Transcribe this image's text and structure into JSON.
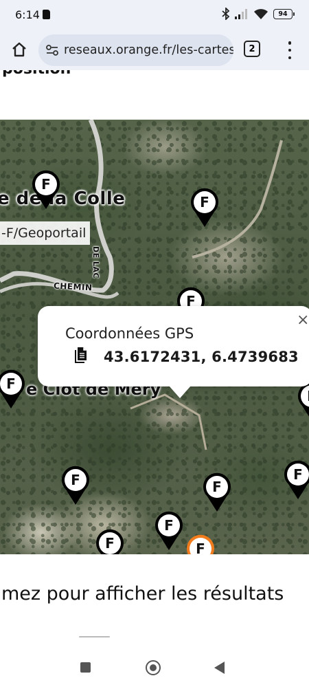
{
  "status_bar": {
    "time": "6:14",
    "battery": "94"
  },
  "toolbar": {
    "url": "reseaux.orange.fr/les-cartes",
    "tab_count": "2"
  },
  "page": {
    "heading": "position",
    "results_prompt": "mez pour afficher les résultats"
  },
  "map": {
    "labels": {
      "place_colle": "e de la Colle",
      "place_clot": "e Clot de Mery",
      "road_chemin": "CHEMIN",
      "road_lac": "DE LAC"
    },
    "attribution": "-F/Geoportail",
    "pin_letter": "F",
    "pins": [
      {
        "color": "#000000"
      },
      {
        "color": "#000000"
      },
      {
        "color": "#000000"
      },
      {
        "color": "#000000"
      },
      {
        "color": "#000000"
      },
      {
        "color": "#000000"
      },
      {
        "color": "#000000"
      },
      {
        "color": "#000000"
      },
      {
        "color": "#000000"
      },
      {
        "color": "#000000"
      },
      {
        "color": "#f07c1e"
      }
    ],
    "popup": {
      "title": "Coordonnées GPS",
      "coordinates": "43.6172431, 6.4739683",
      "close_symbol": "×"
    }
  },
  "icons": {
    "bluetooth": "bluetooth-icon",
    "signal": "signal-icon",
    "wifi": "wifi-icon",
    "home": "home-icon",
    "site_settings": "site-settings-icon",
    "copy": "copy-icon",
    "menu": "more-vert-icon"
  }
}
